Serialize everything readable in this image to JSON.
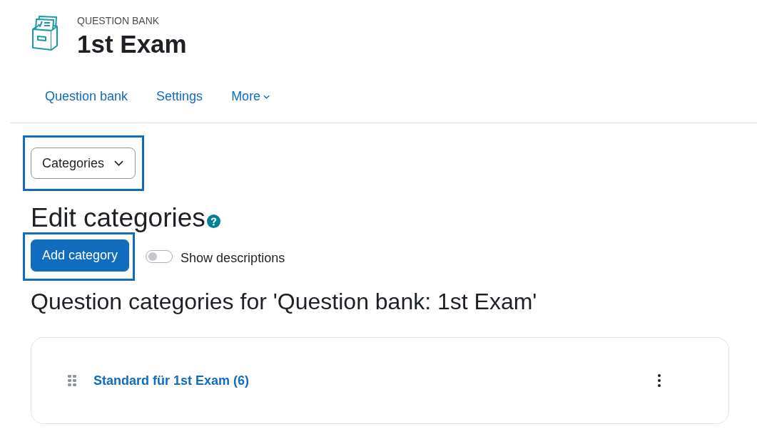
{
  "header": {
    "kicker": "QUESTION BANK",
    "title": "1st Exam"
  },
  "nav": [
    {
      "label": "Question bank",
      "kind": "link"
    },
    {
      "label": "Settings",
      "kind": "link"
    },
    {
      "label": "More",
      "kind": "dropdown"
    }
  ],
  "category_menu": {
    "label": "Categories",
    "highlighted": true
  },
  "page_title": "Edit categories",
  "add_button": {
    "label": "Add category",
    "highlighted": true
  },
  "show_descriptions": {
    "label": "Show descriptions",
    "on": false
  },
  "section_title": "Question categories for 'Question bank: 1st Exam'",
  "categories": [
    {
      "name": "Standard für 1st Exam (6)"
    }
  ]
}
